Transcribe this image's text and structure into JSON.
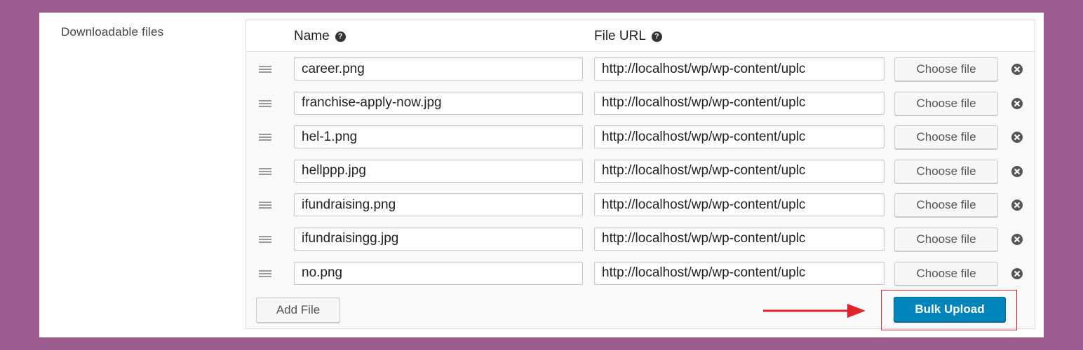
{
  "field": {
    "label": "Downloadable files"
  },
  "columns": {
    "name": "Name",
    "file_url": "File URL"
  },
  "files": [
    {
      "name": "career.png",
      "url": "http://localhost/wp/wp-content/uplc"
    },
    {
      "name": "franchise-apply-now.jpg",
      "url": "http://localhost/wp/wp-content/uplc"
    },
    {
      "name": "hel-1.png",
      "url": "http://localhost/wp/wp-content/uplc"
    },
    {
      "name": "hellppp.jpg",
      "url": "http://localhost/wp/wp-content/uplc"
    },
    {
      "name": "ifundraising.png",
      "url": "http://localhost/wp/wp-content/uplc"
    },
    {
      "name": "ifundraisingg.jpg",
      "url": "http://localhost/wp/wp-content/uplc"
    },
    {
      "name": "no.png",
      "url": "http://localhost/wp/wp-content/uplc"
    }
  ],
  "buttons": {
    "choose_file": "Choose file",
    "add_file": "Add File",
    "bulk_upload": "Bulk Upload"
  },
  "icons": {
    "help": "help-icon",
    "drag": "drag-handle-icon",
    "remove": "remove-icon",
    "arrow": "arrow-right-icon"
  },
  "colors": {
    "frame": "#9b5c8f",
    "primary": "#0085ba",
    "highlight": "#e0232c"
  }
}
